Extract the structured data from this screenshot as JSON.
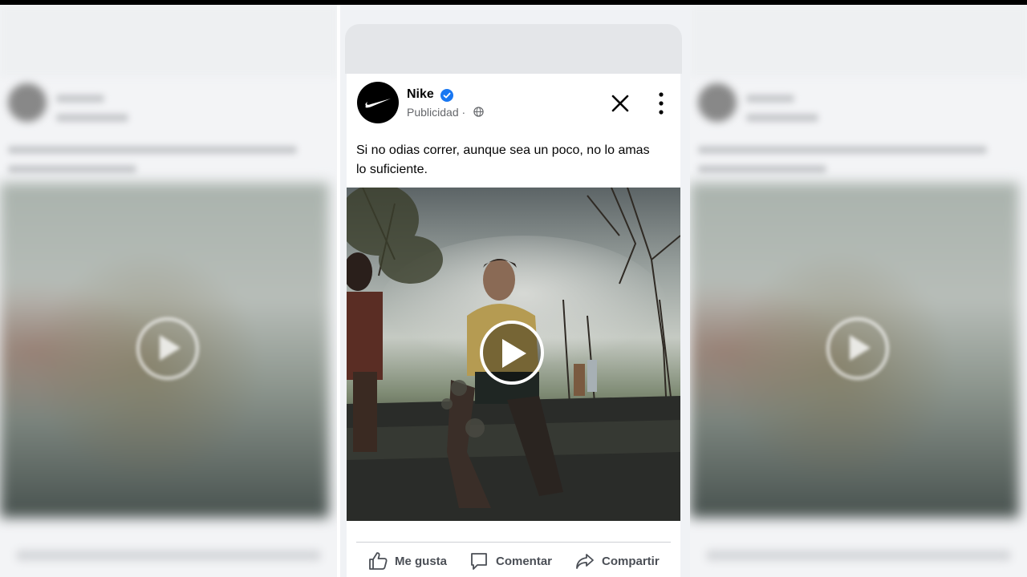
{
  "post": {
    "author": "Nike",
    "label": "Publicidad · ",
    "text": "Si no odias correr, aunque sea un poco, no lo amas lo suficiente.",
    "actions": {
      "like": "Me gusta",
      "comment": "Comentar",
      "share": "Compartir"
    }
  },
  "colors": {
    "verified": "#1877f2",
    "icon_gray": "#65676b",
    "text": "#050505"
  },
  "icons": [
    "nike-logo-icon",
    "verified-icon",
    "globe-icon",
    "close-icon",
    "more-icon",
    "play-icon",
    "like-icon",
    "comment-icon",
    "share-icon"
  ]
}
